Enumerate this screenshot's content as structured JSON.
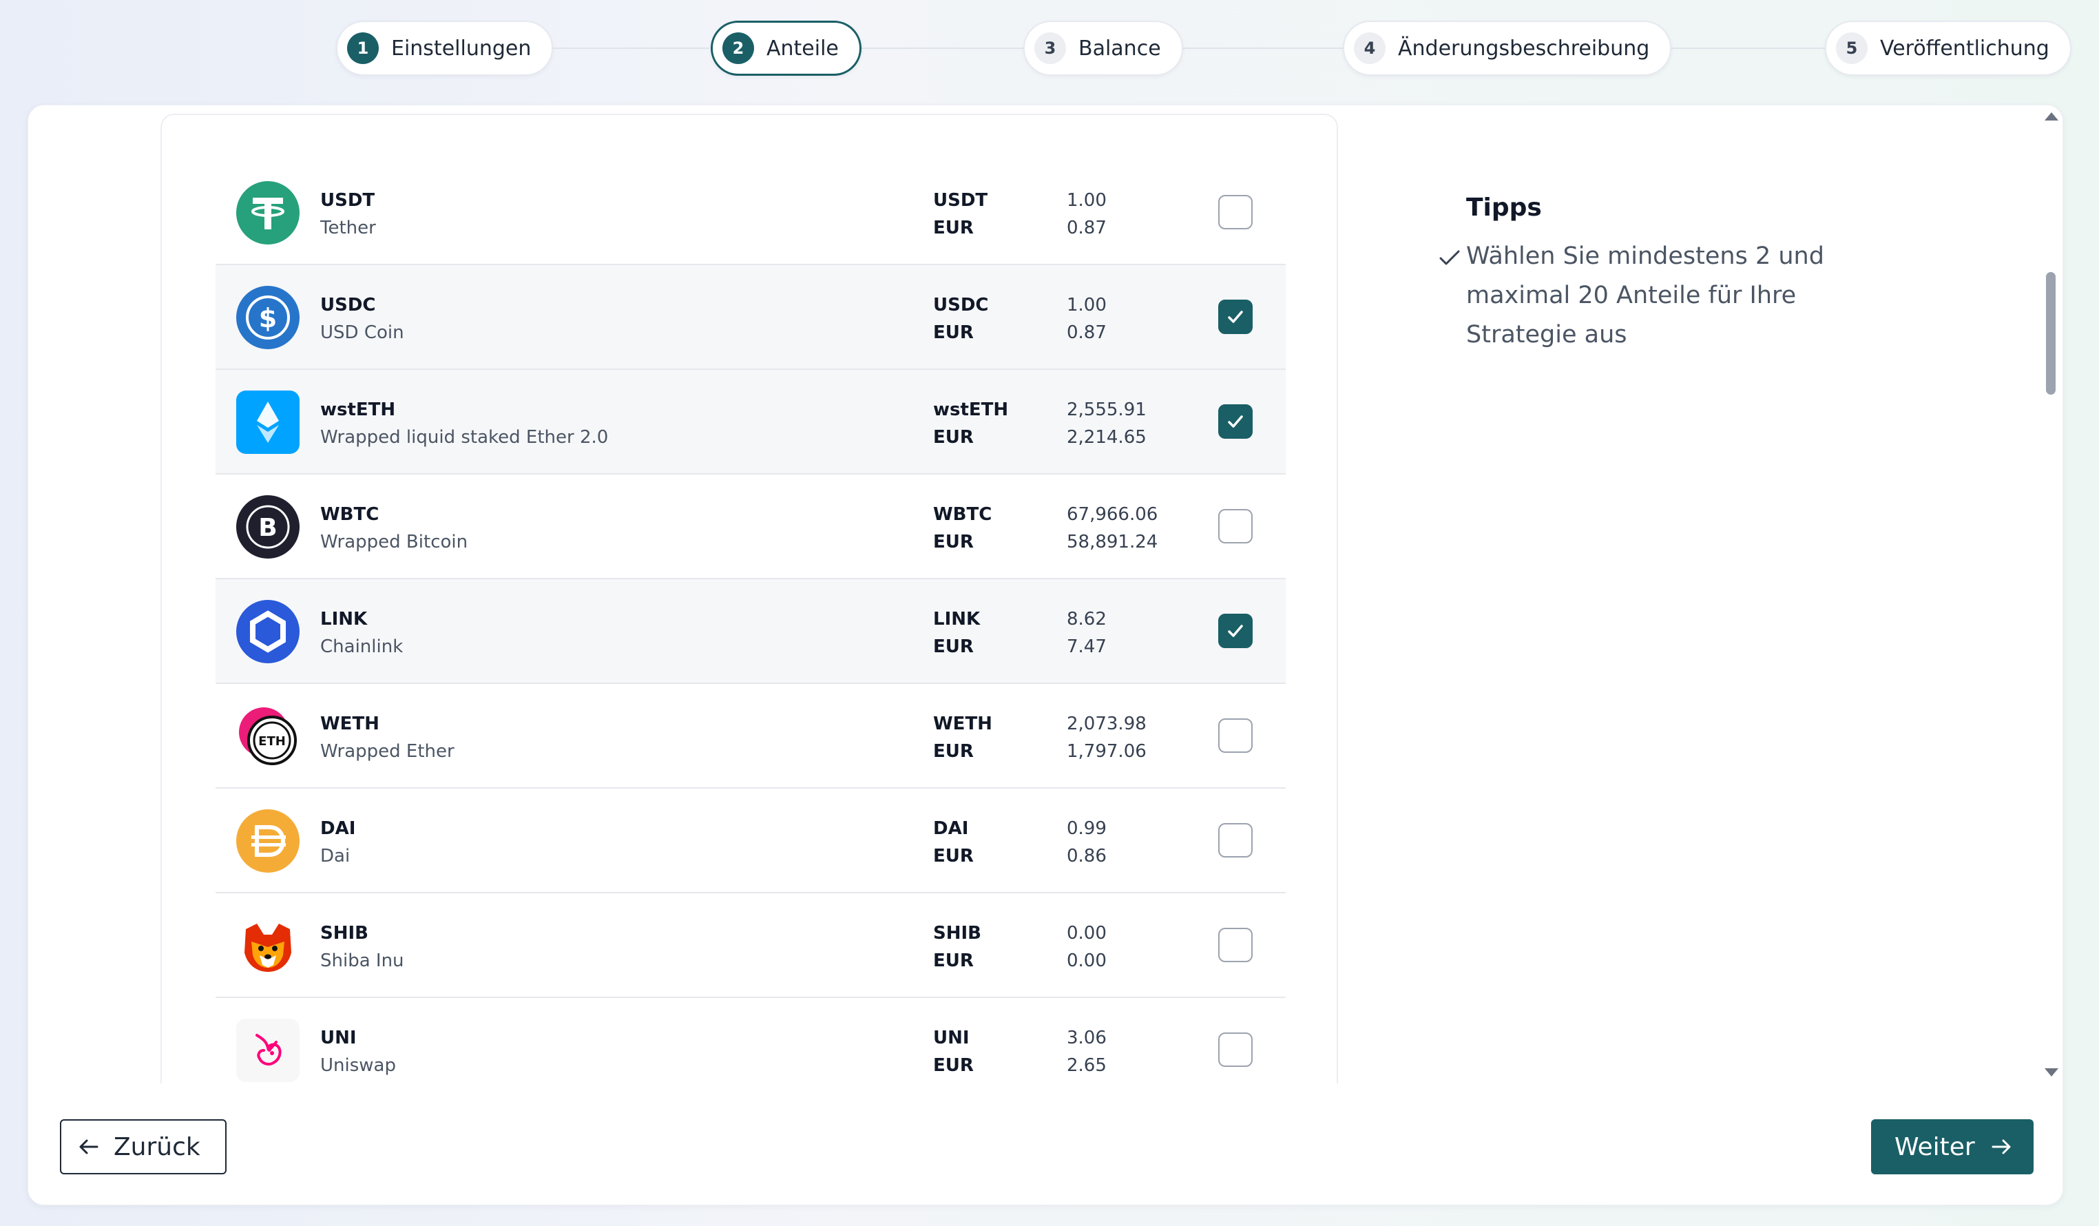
{
  "stepper": {
    "steps": [
      {
        "number": "1",
        "label": "Einstellungen"
      },
      {
        "number": "2",
        "label": "Anteile"
      },
      {
        "number": "3",
        "label": "Balance"
      },
      {
        "number": "4",
        "label": "Änderungsbeschreibung"
      },
      {
        "number": "5",
        "label": "Veröffentlichung"
      }
    ],
    "active_step": "2"
  },
  "assets": [
    {
      "symbol": "USDT",
      "name": "Tether",
      "unit": "USDT",
      "currency": "EUR",
      "price_unit": "1.00",
      "price_eur": "0.87",
      "checked": false,
      "icon": "tether-icon",
      "color": "#26a17b"
    },
    {
      "symbol": "USDC",
      "name": "USD Coin",
      "unit": "USDC",
      "currency": "EUR",
      "price_unit": "1.00",
      "price_eur": "0.87",
      "checked": true,
      "icon": "usdc-icon",
      "color": "#2775ca"
    },
    {
      "symbol": "wstETH",
      "name": "Wrapped liquid staked Ether 2.0",
      "unit": "wstETH",
      "currency": "EUR",
      "price_unit": "2,555.91",
      "price_eur": "2,214.65",
      "checked": true,
      "icon": "wsteth-icon",
      "color": "#00a3ff"
    },
    {
      "symbol": "WBTC",
      "name": "Wrapped Bitcoin",
      "unit": "WBTC",
      "currency": "EUR",
      "price_unit": "67,966.06",
      "price_eur": "58,891.24",
      "checked": false,
      "icon": "wbtc-icon",
      "color": "#1f1f2e"
    },
    {
      "symbol": "LINK",
      "name": "Chainlink",
      "unit": "LINK",
      "currency": "EUR",
      "price_unit": "8.62",
      "price_eur": "7.47",
      "checked": true,
      "icon": "chainlink-icon",
      "color": "#2a5ada"
    },
    {
      "symbol": "WETH",
      "name": "Wrapped Ether",
      "unit": "WETH",
      "currency": "EUR",
      "price_unit": "2,073.98",
      "price_eur": "1,797.06",
      "checked": false,
      "icon": "weth-icon",
      "color": "#ec1c79"
    },
    {
      "symbol": "DAI",
      "name": "Dai",
      "unit": "DAI",
      "currency": "EUR",
      "price_unit": "0.99",
      "price_eur": "0.86",
      "checked": false,
      "icon": "dai-icon",
      "color": "#f5ac37"
    },
    {
      "symbol": "SHIB",
      "name": "Shiba Inu",
      "unit": "SHIB",
      "currency": "EUR",
      "price_unit": "0.00",
      "price_eur": "0.00",
      "checked": false,
      "icon": "shiba-inu-icon",
      "color": "#e42d04"
    },
    {
      "symbol": "UNI",
      "name": "Uniswap",
      "unit": "UNI",
      "currency": "EUR",
      "price_unit": "3.06",
      "price_eur": "2.65",
      "checked": false,
      "icon": "uniswap-icon",
      "color": "#ff007a"
    }
  ],
  "tips": {
    "title": "Tipps",
    "items": [
      "Wählen Sie mindestens 2 und maximal 20 Anteile für Ihre Strategie aus"
    ]
  },
  "footer": {
    "back_label": "Zurück",
    "next_label": "Weiter"
  },
  "colors": {
    "accent": "#1a5f66",
    "border": "#e6e8ec"
  }
}
